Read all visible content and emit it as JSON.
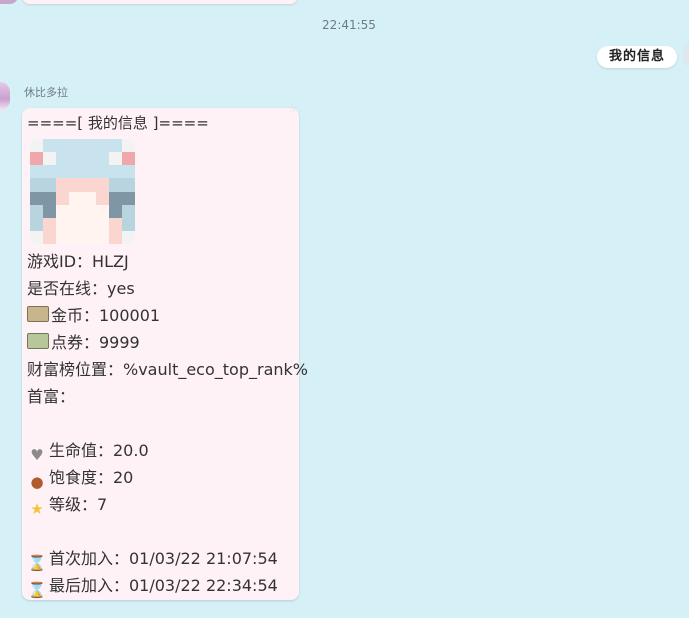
{
  "timestamp": "22:41:55",
  "self_message": {
    "text": "我的信息"
  },
  "peer": {
    "name": "休比多拉"
  },
  "message": {
    "header": "====[ 我的信息 ]====",
    "game_id": "游戏ID：HLZJ",
    "online": "是否在线：yes",
    "gold": "金币：100001",
    "points": "点券：9999",
    "wealth_rank": "财富榜位置：%vault_eco_top_rank%",
    "richest": "首富：",
    "health": "生命值：20.0",
    "hunger": "饱食度：20",
    "level": "等级：7",
    "first_join": "首次加入：01/03/22 21:07:54",
    "last_join": "最后加入：01/03/22 22:34:54"
  },
  "icons": {
    "gold": "money-icon",
    "points": "ticket-icon",
    "health": "heart-icon",
    "hunger": "meat-icon",
    "level": "star-icon",
    "first_join": "hourglass-icon",
    "last_join": "hourglass-icon"
  },
  "colors": {
    "background": "#d6f0f7",
    "bubble": "#fff2f7",
    "text": "#333333"
  }
}
